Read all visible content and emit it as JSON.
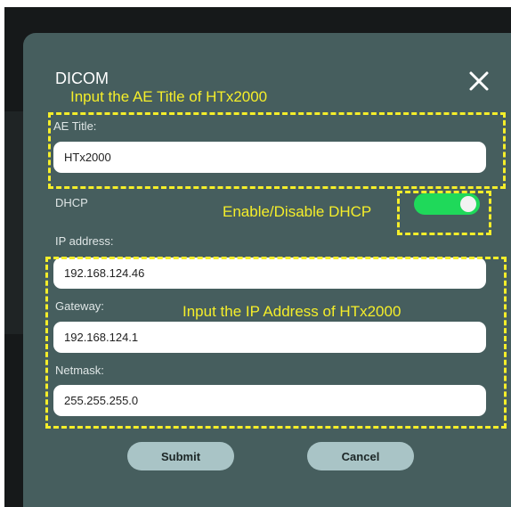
{
  "dialog": {
    "title": "DICOM",
    "close_icon": "close-icon",
    "ae_title_label": "AE Title:",
    "ae_title_value": "HTx2000",
    "dhcp_label": "DHCP",
    "dhcp_enabled": true,
    "ip_label": "IP address:",
    "ip_value": "192.168.124.46",
    "gateway_label": "Gateway:",
    "gateway_value": "192.168.124.1",
    "netmask_label": "Netmask:",
    "netmask_value": "255.255.255.0",
    "submit_label": "Submit",
    "cancel_label": "Cancel"
  },
  "annotations": {
    "ae_title": "Input the AE Title of HTx2000",
    "dhcp": "Enable/Disable DHCP",
    "ip": "Input the IP Address of HTx2000"
  },
  "colors": {
    "dialog_bg": "#465e5e",
    "toggle_on": "#1fd95a",
    "button_bg": "#a9c4c6",
    "annotation": "#f5ee2a"
  }
}
